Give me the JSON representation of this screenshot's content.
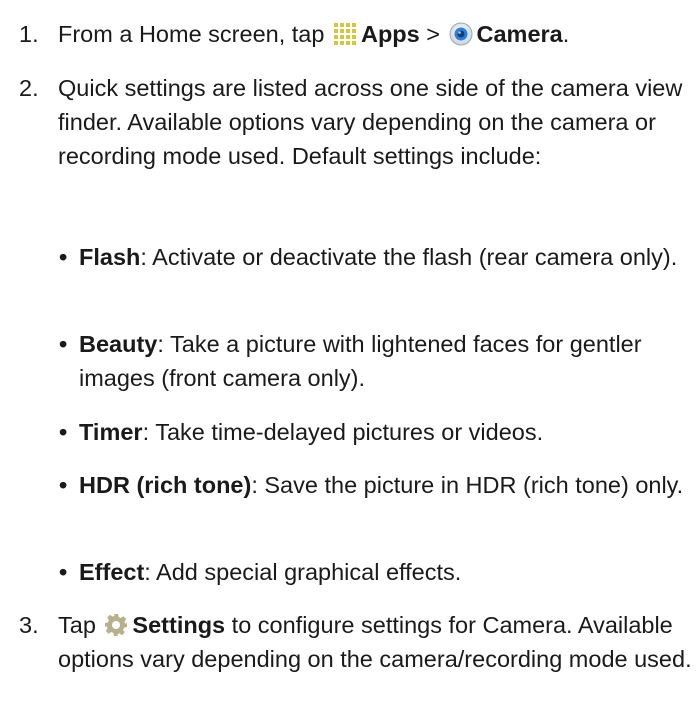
{
  "steps": [
    {
      "number": "1.",
      "prefix": "From a Home screen, tap",
      "apps_label": "Apps",
      "separator": ">",
      "camera_label": "Camera",
      "suffix": ".",
      "icons": [
        "apps-grid-icon",
        "camera-app-icon"
      ]
    },
    {
      "number": "2.",
      "text": "Quick settings are listed across one side of the camera view finder. Available options vary depending on the camera or recording mode used. Default settings include:",
      "bullets": [
        {
          "term": "Flash",
          "desc": ": Activate or deactivate the flash (rear camera only)."
        },
        {
          "term": "Beauty",
          "desc": ": Take a picture with lightened faces for gentler images (front camera only)."
        },
        {
          "term": "Timer",
          "desc": ": Take time-delayed pictures or videos."
        },
        {
          "term": "HDR (rich tone)",
          "desc": ": Save the picture in HDR (rich tone) only."
        },
        {
          "term": "Effect",
          "desc": ": Add special graphical effects."
        }
      ]
    },
    {
      "number": "3.",
      "prefix": "Tap",
      "settings_label": "Settings",
      "suffix": " to configure settings for Camera. Available options vary depending on the camera/recording mode used.",
      "icons": [
        "settings-gear-icon"
      ]
    }
  ],
  "bullet_glyph": "•",
  "colors": {
    "text": "#1a1a1a",
    "apps_icon_dots": "#d4c640",
    "camera_icon_blue": "#2f7fd8",
    "settings_gear": "#b8b08c"
  }
}
